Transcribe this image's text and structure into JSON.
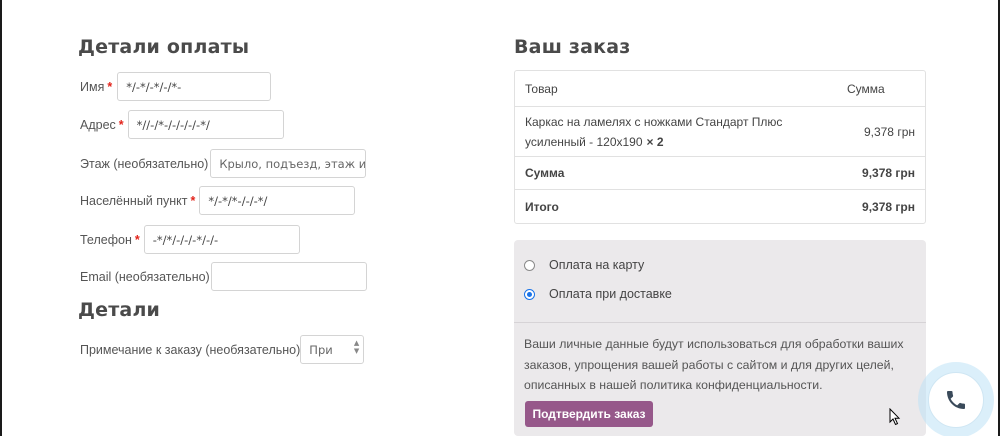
{
  "billing": {
    "title": "Детали оплаты",
    "fields": {
      "name": {
        "label": "Имя",
        "value": "*/-*/-*/-/*-"
      },
      "address": {
        "label": "Адрес",
        "value": "*//-/*-/-/-/-/-*/"
      },
      "floor": {
        "label": "Этаж (необязательно)",
        "placeholder": "Крыло, подъезд, этаж и т"
      },
      "city": {
        "label": "Населённый пункт",
        "value": "*/-*/*-/-/-*/"
      },
      "phone": {
        "label": "Телефон",
        "value": "-*/*/-/-/-*/-/-"
      },
      "email": {
        "label": "Email (необязательно)",
        "value": ""
      }
    },
    "required_mark": "*"
  },
  "details": {
    "title": "Детали",
    "note_label": "Примечание к заказу (необязательно)",
    "note_placeholder": "При"
  },
  "order": {
    "title": "Ваш заказ",
    "table": {
      "header": {
        "product": "Товар",
        "sum": "Сумма"
      },
      "item": {
        "name": "Каркас на ламелях с ножками Стандарт Плюс усиленный - 120x190",
        "qty": "× 2",
        "price": "9,378 грн"
      },
      "subtotal": {
        "label": "Сумма",
        "value": "9,378 грн"
      },
      "total": {
        "label": "Итого",
        "value": "9,378 грн"
      }
    }
  },
  "payment": {
    "options": [
      {
        "label": "Оплата на карту",
        "selected": false
      },
      {
        "label": "Оплата при доставке",
        "selected": true
      }
    ],
    "privacy_text": "Ваши личные данные будут использоваться для обработки ваших заказов, упрощения вашей работы с сайтом и для других целей, описанных в нашей",
    "privacy_link": "политика конфиденциальности",
    "privacy_end": ".",
    "submit_label": "Подтвердить заказ"
  },
  "colors": {
    "accent": "#96588a",
    "required": "#e2231a",
    "payment_bg": "#ebe9eb"
  },
  "icons": {
    "call": "phone-icon",
    "cursor": "mouse-pointer-icon"
  }
}
